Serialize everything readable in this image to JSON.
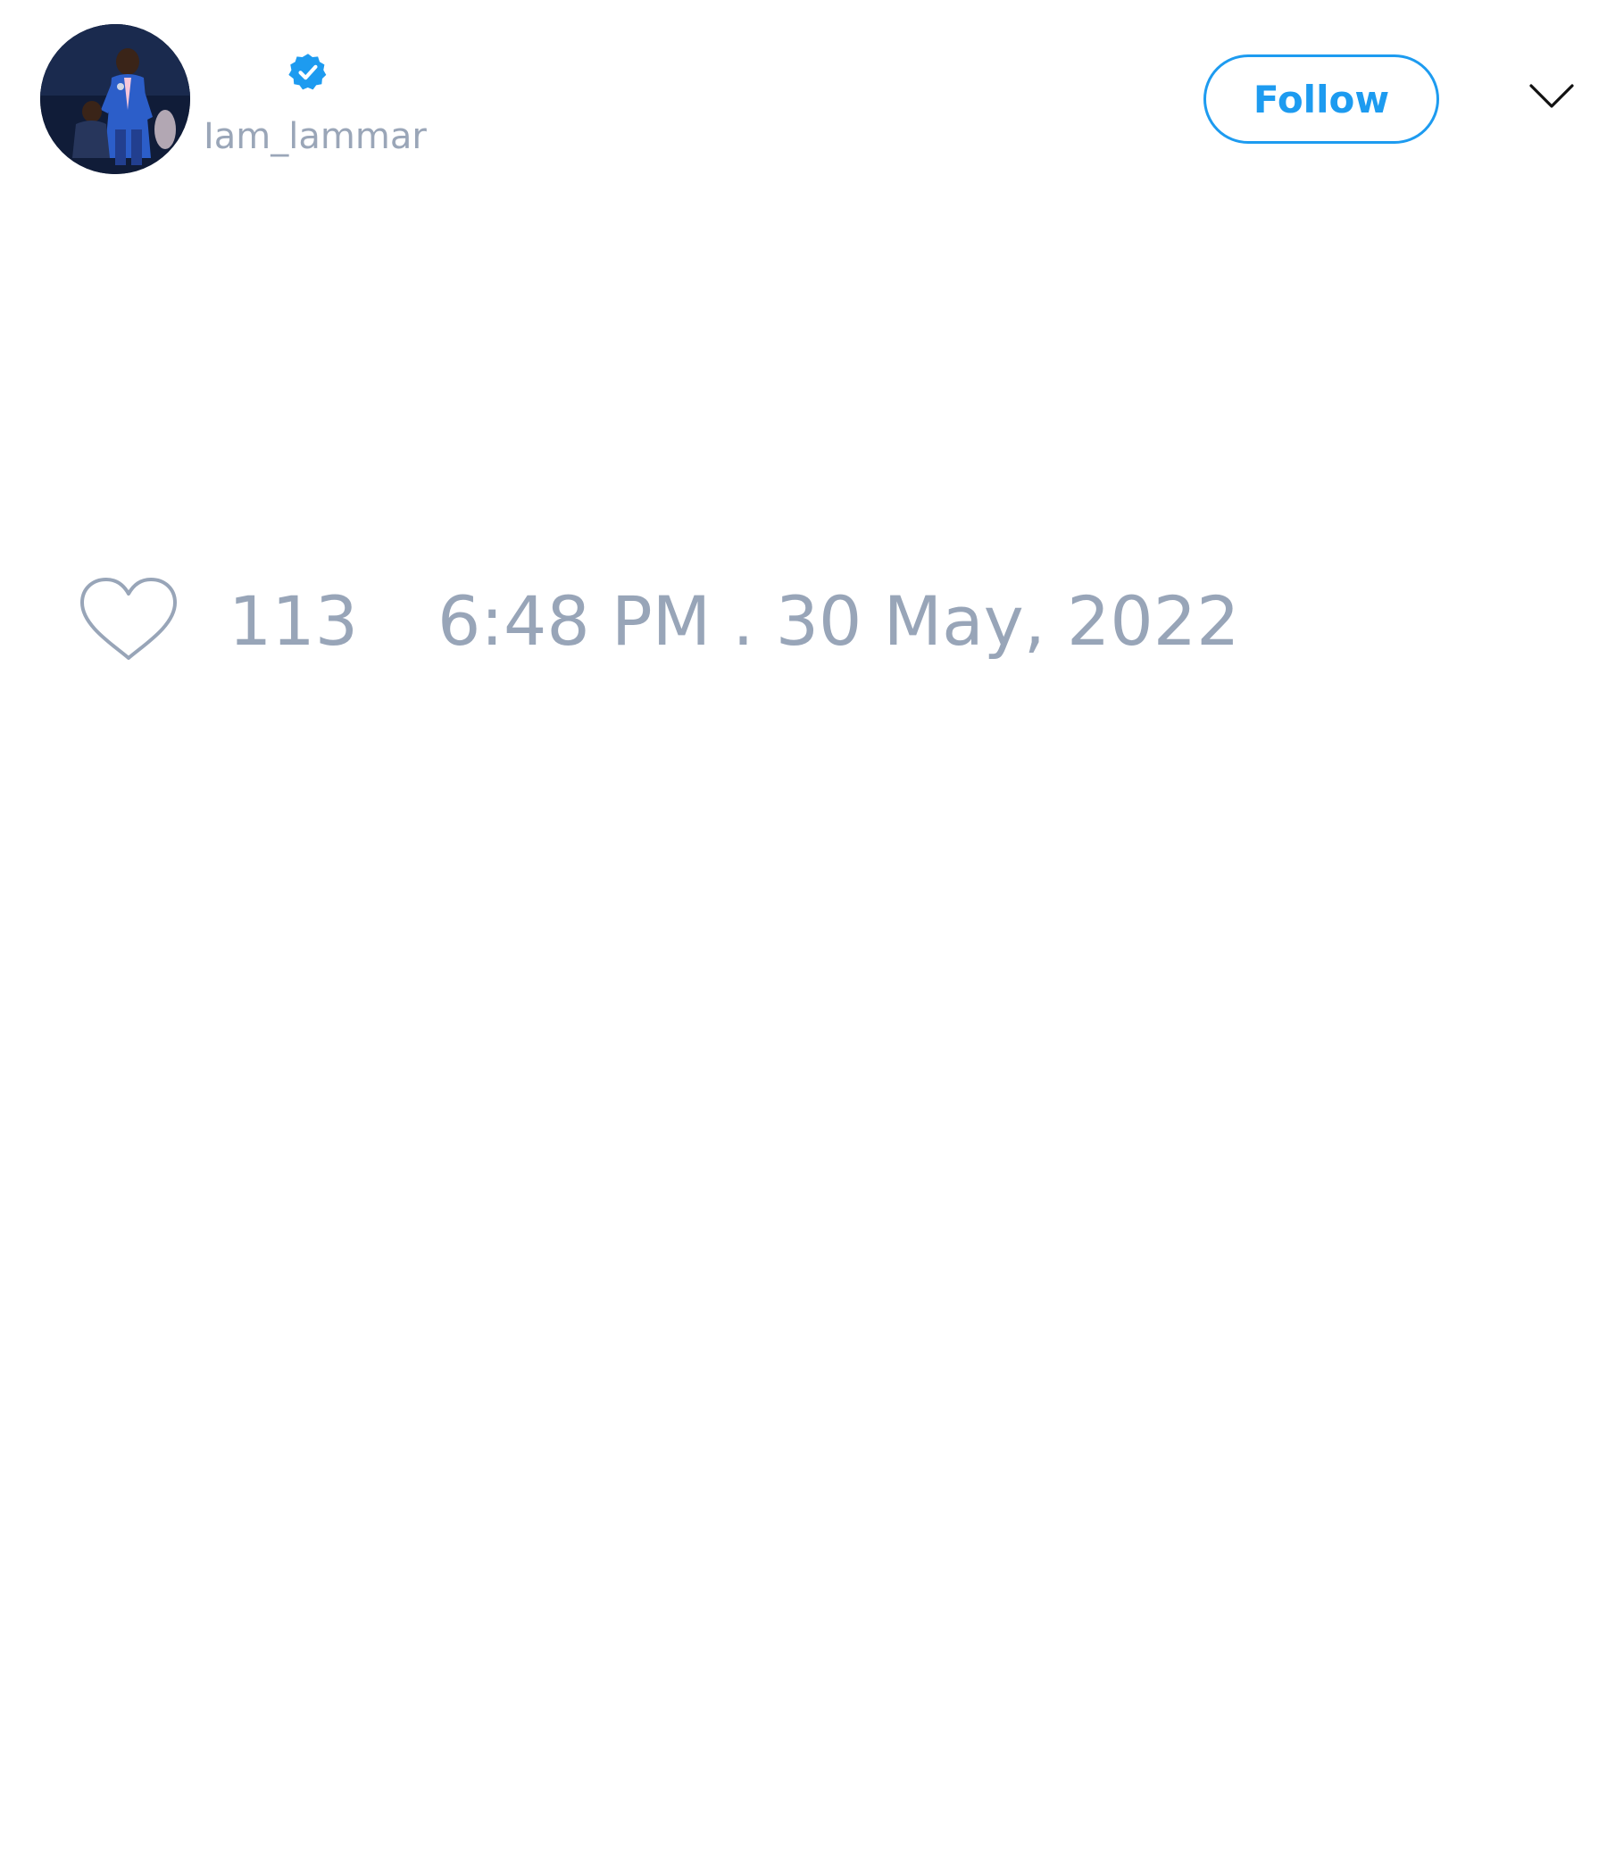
{
  "author": {
    "handle": "Iam_lammar",
    "verified": true,
    "avatar_icon": "user-avatar-photo"
  },
  "header": {
    "follow_label": "Follow",
    "menu_icon": "chevron-down-icon"
  },
  "footer": {
    "like_icon": "heart-outline-icon",
    "like_count": "113",
    "timestamp": "6:48 PM . 30 May, 2022"
  },
  "colors": {
    "accent": "#1d9bf0",
    "muted_text": "#98a5b8",
    "background": "#ffffff"
  }
}
